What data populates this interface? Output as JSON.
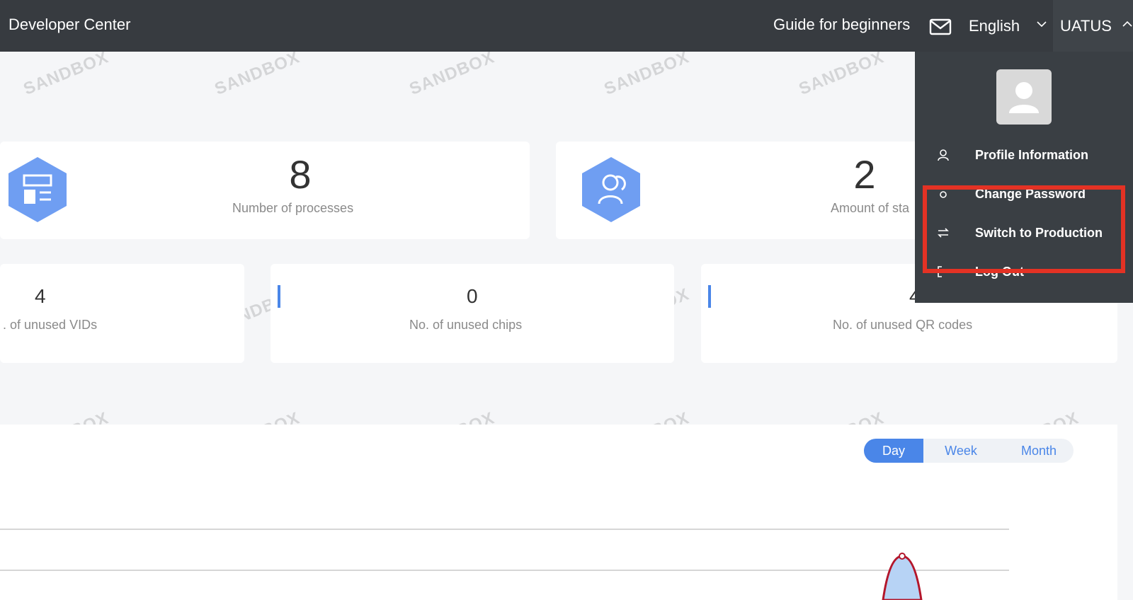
{
  "topbar": {
    "brand": "Developer Center",
    "guide": "Guide for beginners",
    "language": "English",
    "user": "UATUS"
  },
  "stats_row1": [
    {
      "value": "8",
      "label": "Number of processes"
    },
    {
      "value": "2",
      "label": "Amount of sta"
    }
  ],
  "stats_row2": [
    {
      "value": "4",
      "label": ". of unused VIDs"
    },
    {
      "value": "0",
      "label": "No. of unused chips"
    },
    {
      "value": "4",
      "label": "No. of unused QR codes"
    }
  ],
  "chart_controls": {
    "options": [
      "Day",
      "Week",
      "Month"
    ],
    "selected": "Day"
  },
  "user_menu": {
    "items": [
      {
        "label": "Profile Information",
        "icon": "user-icon"
      },
      {
        "label": "Change Password",
        "icon": "key-icon"
      },
      {
        "label": "Switch to Production",
        "icon": "switch-icon"
      },
      {
        "label": "Log Out",
        "icon": "logout-icon"
      }
    ]
  },
  "watermark": "SANDBOX",
  "colors": {
    "topbar": "#373b40",
    "accent": "#4a86e8",
    "highlight": "#e43224",
    "hex_icon": "#6f9ef2"
  }
}
